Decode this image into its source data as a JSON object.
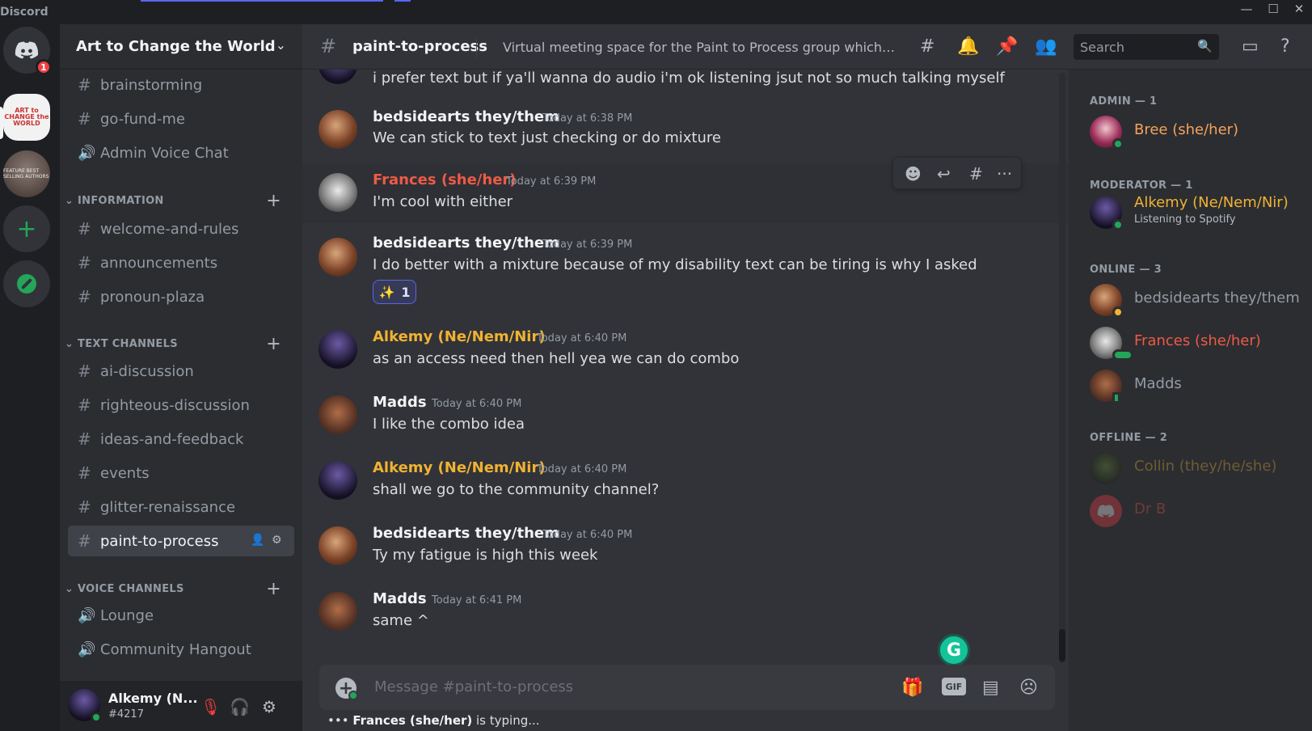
{
  "app": {
    "name": "Discord",
    "win_min": "—",
    "win_max": "☐",
    "win_close": "✕"
  },
  "rail": {
    "home_badge": "1",
    "art_label": "ART to CHANGE the WORLD",
    "feat_label": "FEATURE BEST SELLING AUTHORS",
    "add": "+"
  },
  "server": {
    "name": "Art to Change the World",
    "chevron": "⌄"
  },
  "channels_top": [
    {
      "name": "brainstorming",
      "type": "text"
    },
    {
      "name": "go-fund-me",
      "type": "text"
    },
    {
      "name": "Admin Voice Chat",
      "type": "voice"
    }
  ],
  "categories": {
    "information": {
      "label": "INFORMATION",
      "plus": "+"
    },
    "text": {
      "label": "TEXT CHANNELS",
      "plus": "+"
    },
    "voice": {
      "label": "VOICE CHANNELS",
      "plus": "+"
    }
  },
  "info_channels": [
    "welcome-and-rules",
    "announcements",
    "pronoun-plaza"
  ],
  "text_channels": [
    "ai-discussion",
    "righteous-discussion",
    "ideas-and-feedback",
    "events",
    "glitter-renaissance",
    "paint-to-process"
  ],
  "voice_channels": [
    "Lounge",
    "Community Hangout"
  ],
  "glyphs": {
    "hash": "#",
    "speaker": "🔊",
    "threads": "#",
    "bell": "🔔",
    "pin": "📌",
    "members": "👥",
    "search": "🔍",
    "inbox": "▭",
    "help": "?",
    "mute": "🎙",
    "headphones": "🎧",
    "gear": "⚙",
    "invite": "👤",
    "react": "☻",
    "reply": "↩",
    "more": "···",
    "gift": "🎁",
    "sticker": "▤",
    "emoji": "☹"
  },
  "user": {
    "name": "Alkemy (N...",
    "tag": "#4217"
  },
  "channel": {
    "name": "paint-to-process",
    "topic": "Virtual meeting space for the Paint to Process group which mee..."
  },
  "search": {
    "placeholder": "Search"
  },
  "messages": {
    "m0": {
      "content": "i prefer text but if ya'll wanna do audio i'm ok listening jsut not so much talking myself"
    },
    "m1": {
      "author": "bedsidearts they/them",
      "ts": "Today at 6:38 PM",
      "content": "We can stick to text just checking or do  mixture"
    },
    "m2": {
      "author": "Frances (she/her)",
      "ts": "Today at 6:39 PM",
      "content": "I'm cool with either"
    },
    "m3": {
      "author": "bedsidearts they/them",
      "ts": "Today at 6:39 PM",
      "content": "I do better with a mixture because of my disability text can be tiring is why I asked",
      "reaction_emoji": "✨",
      "reaction_count": "1"
    },
    "m4": {
      "author": "Alkemy (Ne/Nem/Nir)",
      "ts": "Today at 6:40 PM",
      "content": "as an access need then hell yea we can do combo"
    },
    "m5": {
      "author": "Madds",
      "ts": "Today at 6:40 PM",
      "content": "I like the combo idea"
    },
    "m6": {
      "author": "Alkemy (Ne/Nem/Nir)",
      "ts": "Today at 6:40 PM",
      "content": "shall we go to the community channel?"
    },
    "m7": {
      "author": "bedsidearts they/them",
      "ts": "Today at 6:40 PM",
      "content": "Ty my fatigue is high this week"
    },
    "m8": {
      "author": "Madds",
      "ts": "Today at 6:41 PM",
      "content": "same ^"
    }
  },
  "composer": {
    "placeholder": "Message #paint-to-process",
    "gif": "GIF",
    "add": "+"
  },
  "typing": {
    "user": "Frances (she/her)",
    "suffix": " is typing...",
    "dots": "•••"
  },
  "grammarly": "G",
  "members": {
    "admin_label": "ADMIN — 1",
    "moderator_label": "MODERATOR — 1",
    "online_label": "ONLINE — 3",
    "offline_label": "OFFLINE — 2",
    "bree": "Bree (she/her)",
    "alkemy": "Alkemy (Ne/Nem/Nir)",
    "alkemy_activity": "Listening to Spotify",
    "bedside": "bedsidearts they/them",
    "frances": "Frances (she/her)",
    "madds": "Madds",
    "collin": "Collin (they/he/she)",
    "drb": "Dr B"
  },
  "colors": {
    "accent": "#5865f2",
    "online": "#23a55a",
    "idle": "#f0b232",
    "admin_name": "#f5a25a",
    "mod_name": "#f0b232",
    "frances_name": "#ee5a46"
  }
}
